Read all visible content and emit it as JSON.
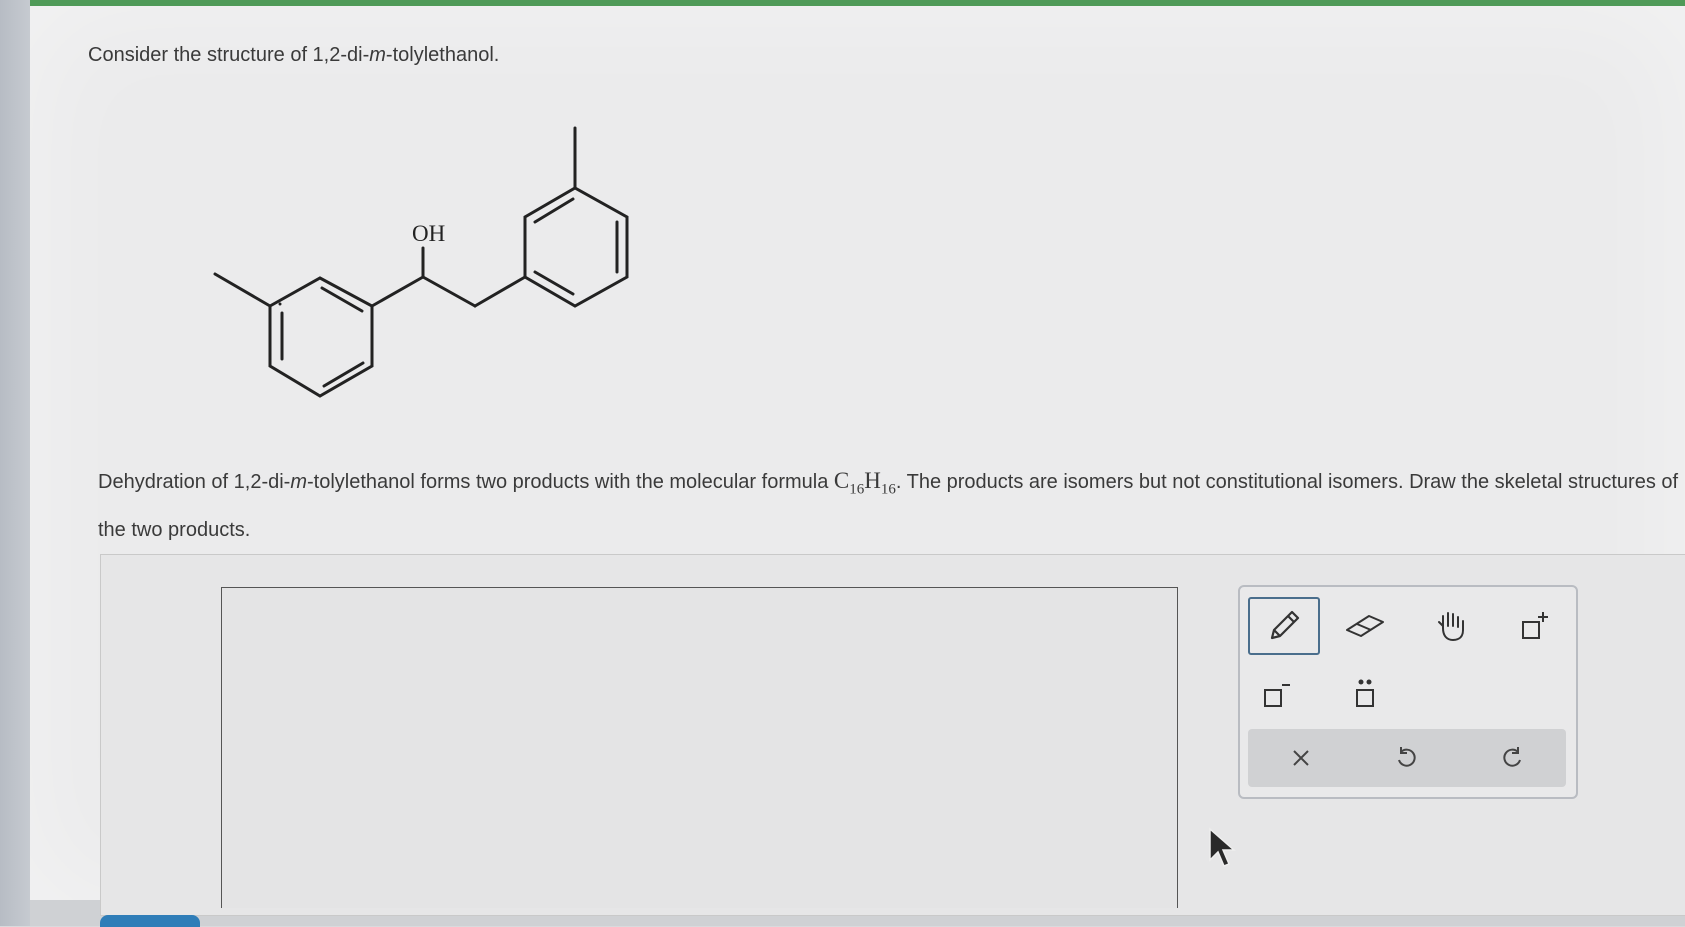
{
  "question": {
    "intro_prefix": "Consider the structure of 1,2-di-",
    "intro_italic": "m",
    "intro_suffix": "-tolylethanol.",
    "oh_label": "OH",
    "desc_part1": "Dehydration of 1,2-di-",
    "desc_italic": "m",
    "desc_part2": "-tolylethanol forms two products with the molecular formula",
    "formula_c": "C",
    "formula_c_sub": "16",
    "formula_h": "H",
    "formula_h_sub": "16",
    "desc_part3": ". The products are isomers but not constitutional isomers. Draw the skeletal structures of the two products."
  },
  "toolbox": {
    "tools": [
      "pencil-icon",
      "eraser-icon",
      "hand-icon",
      "positive-charge-icon",
      "negative-charge-icon",
      "lone-pair-icon"
    ],
    "selected_tool": "pencil-icon",
    "actions": [
      "clear-icon",
      "undo-icon",
      "redo-icon"
    ]
  },
  "colors": {
    "accent_border": "#4a6e8c",
    "top_bar": "#4f9a58",
    "bottom_tab": "#2f7db8"
  }
}
